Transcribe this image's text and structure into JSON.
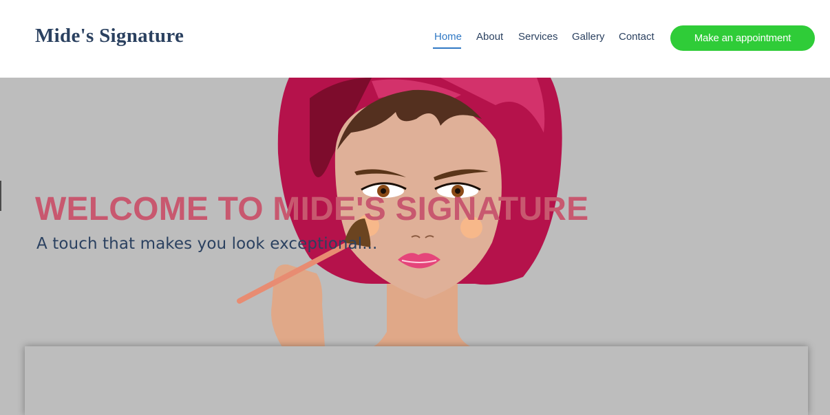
{
  "header": {
    "brand": "Mide's Signature",
    "nav": [
      {
        "label": "Home",
        "active": true
      },
      {
        "label": "About",
        "active": false
      },
      {
        "label": "Services",
        "active": false
      },
      {
        "label": "Gallery",
        "active": false
      },
      {
        "label": "Contact",
        "active": false
      }
    ],
    "cta_label": "Make an appointment"
  },
  "hero": {
    "title": "WELCOME TO MIDE'S SIGNATURE",
    "subtitle": "A touch that makes you look exceptional..."
  },
  "colors": {
    "background": "#bdbdbd",
    "brand_text": "#2b4160",
    "nav_active": "#2f78c4",
    "cta": "#2fcc38",
    "hero_title": "#c8586f",
    "headwrap": "#b5124b"
  }
}
